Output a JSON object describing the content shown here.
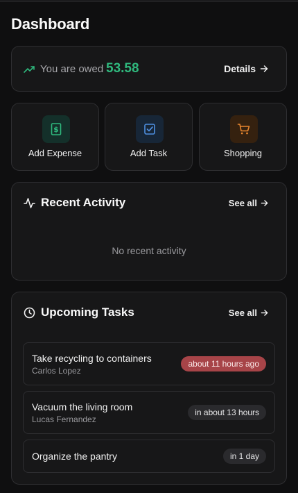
{
  "page": {
    "title": "Dashboard"
  },
  "owed": {
    "label": "You are owed",
    "amount": "53.58",
    "details_label": "Details"
  },
  "actions": [
    {
      "label": "Add Expense",
      "icon": "dollar-receipt-icon",
      "color": "#2fb87d"
    },
    {
      "label": "Add Task",
      "icon": "checkbox-icon",
      "color": "#4e8fe0"
    },
    {
      "label": "Shopping",
      "icon": "shopping-cart-icon",
      "color": "#e8862e"
    }
  ],
  "recent_activity": {
    "title": "Recent Activity",
    "see_all": "See all",
    "empty_text": "No recent activity"
  },
  "upcoming_tasks": {
    "title": "Upcoming Tasks",
    "see_all": "See all",
    "items": [
      {
        "name": "Take recycling to containers",
        "assignee": "Carlos Lopez",
        "due": "about 11 hours ago",
        "overdue": true
      },
      {
        "name": "Vacuum the living room",
        "assignee": "Lucas Fernandez",
        "due": "in about 13 hours",
        "overdue": false
      },
      {
        "name": "Organize the pantry",
        "assignee": "",
        "due": "in 1 day",
        "overdue": false
      }
    ]
  }
}
